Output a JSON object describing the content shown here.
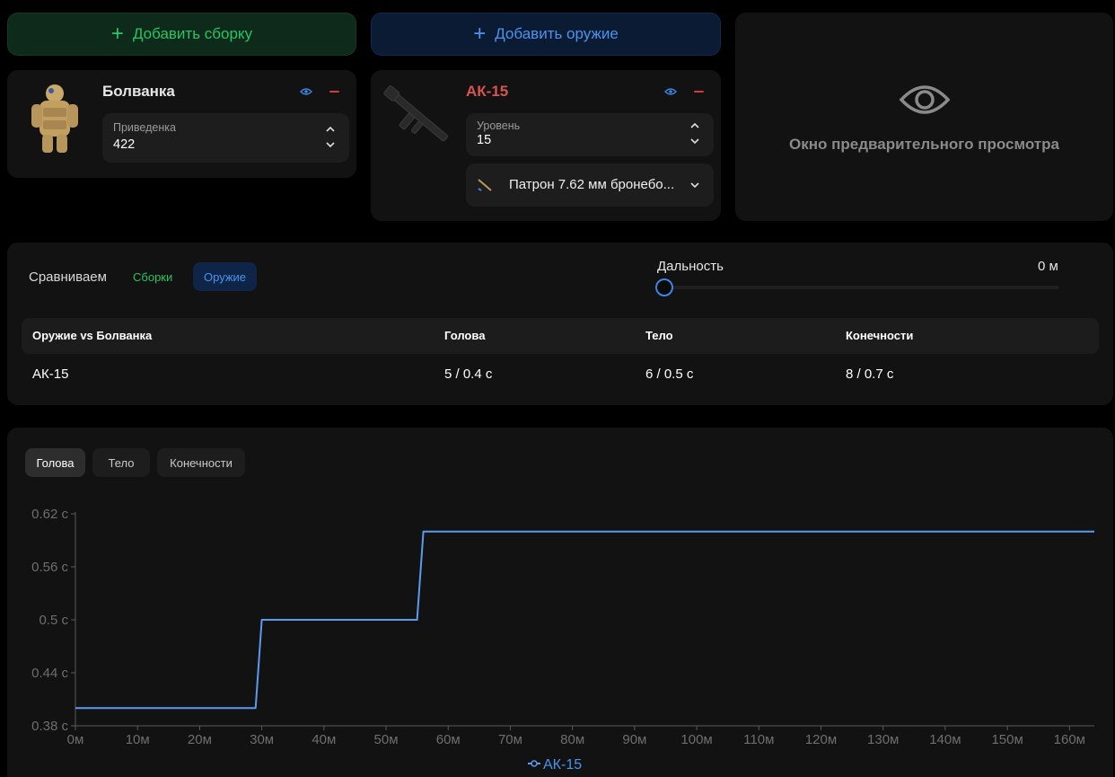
{
  "top_buttons": {
    "add_build": "Добавить сборку",
    "add_weapon": "Добавить оружие"
  },
  "build_card": {
    "title": "Болванка",
    "stepper_label": "Приведенка",
    "stepper_value": "422"
  },
  "weapon_card": {
    "title": "АК-15",
    "title_color": "#d9534f",
    "stepper_label": "Уровень",
    "stepper_value": "15",
    "ammo": "Патрон 7.62 мм бронебо..."
  },
  "preview": {
    "text": "Окно предварительного просмотра"
  },
  "compare": {
    "label": "Сравниваем",
    "chips": [
      "Сборки",
      "Оружие"
    ],
    "active_chip": "Оружие",
    "range_label": "Дальность",
    "range_value": "0 м",
    "range_slider": 0,
    "table": {
      "headers": [
        "Оружие vs Болванка",
        "Голова",
        "Тело",
        "Конечности"
      ],
      "rows": [
        [
          "АК-15",
          "5 / 0.4 с",
          "6 / 0.5 с",
          "8 / 0.7 с"
        ]
      ]
    }
  },
  "chart_tabs": [
    "Голова",
    "Тело",
    "Конечности"
  ],
  "active_chart_tab": "Голова",
  "colors": {
    "green": "#29c463",
    "blue": "#4b93ee",
    "red": "#d23c3c",
    "line": "#5b9bef"
  },
  "chart_data": {
    "type": "line",
    "x_unit": "м",
    "y_unit": "с",
    "xlim": [
      0,
      164
    ],
    "ylim": [
      0.38,
      0.62
    ],
    "x_ticks": [
      0,
      10,
      20,
      30,
      40,
      50,
      60,
      70,
      80,
      90,
      100,
      110,
      120,
      130,
      140,
      150,
      160
    ],
    "y_ticks": [
      0.38,
      0.44,
      0.5,
      0.56,
      0.62
    ],
    "y_tick_labels": [
      "0.38 с",
      "0.44 с",
      "0.5 с",
      "0.56 с",
      "0.62 с"
    ],
    "x_tick_labels": [
      "0м",
      "10м",
      "20м",
      "30м",
      "40м",
      "50м",
      "60м",
      "70м",
      "80м",
      "90м",
      "100м",
      "110м",
      "120м",
      "130м",
      "140м",
      "150м",
      "160м"
    ],
    "series": [
      {
        "name": "АК-15",
        "color": "#5b9bef",
        "x": [
          0,
          29,
          30,
          55,
          56,
          164
        ],
        "values": [
          0.4,
          0.4,
          0.5,
          0.5,
          0.6,
          0.6
        ]
      }
    ]
  }
}
